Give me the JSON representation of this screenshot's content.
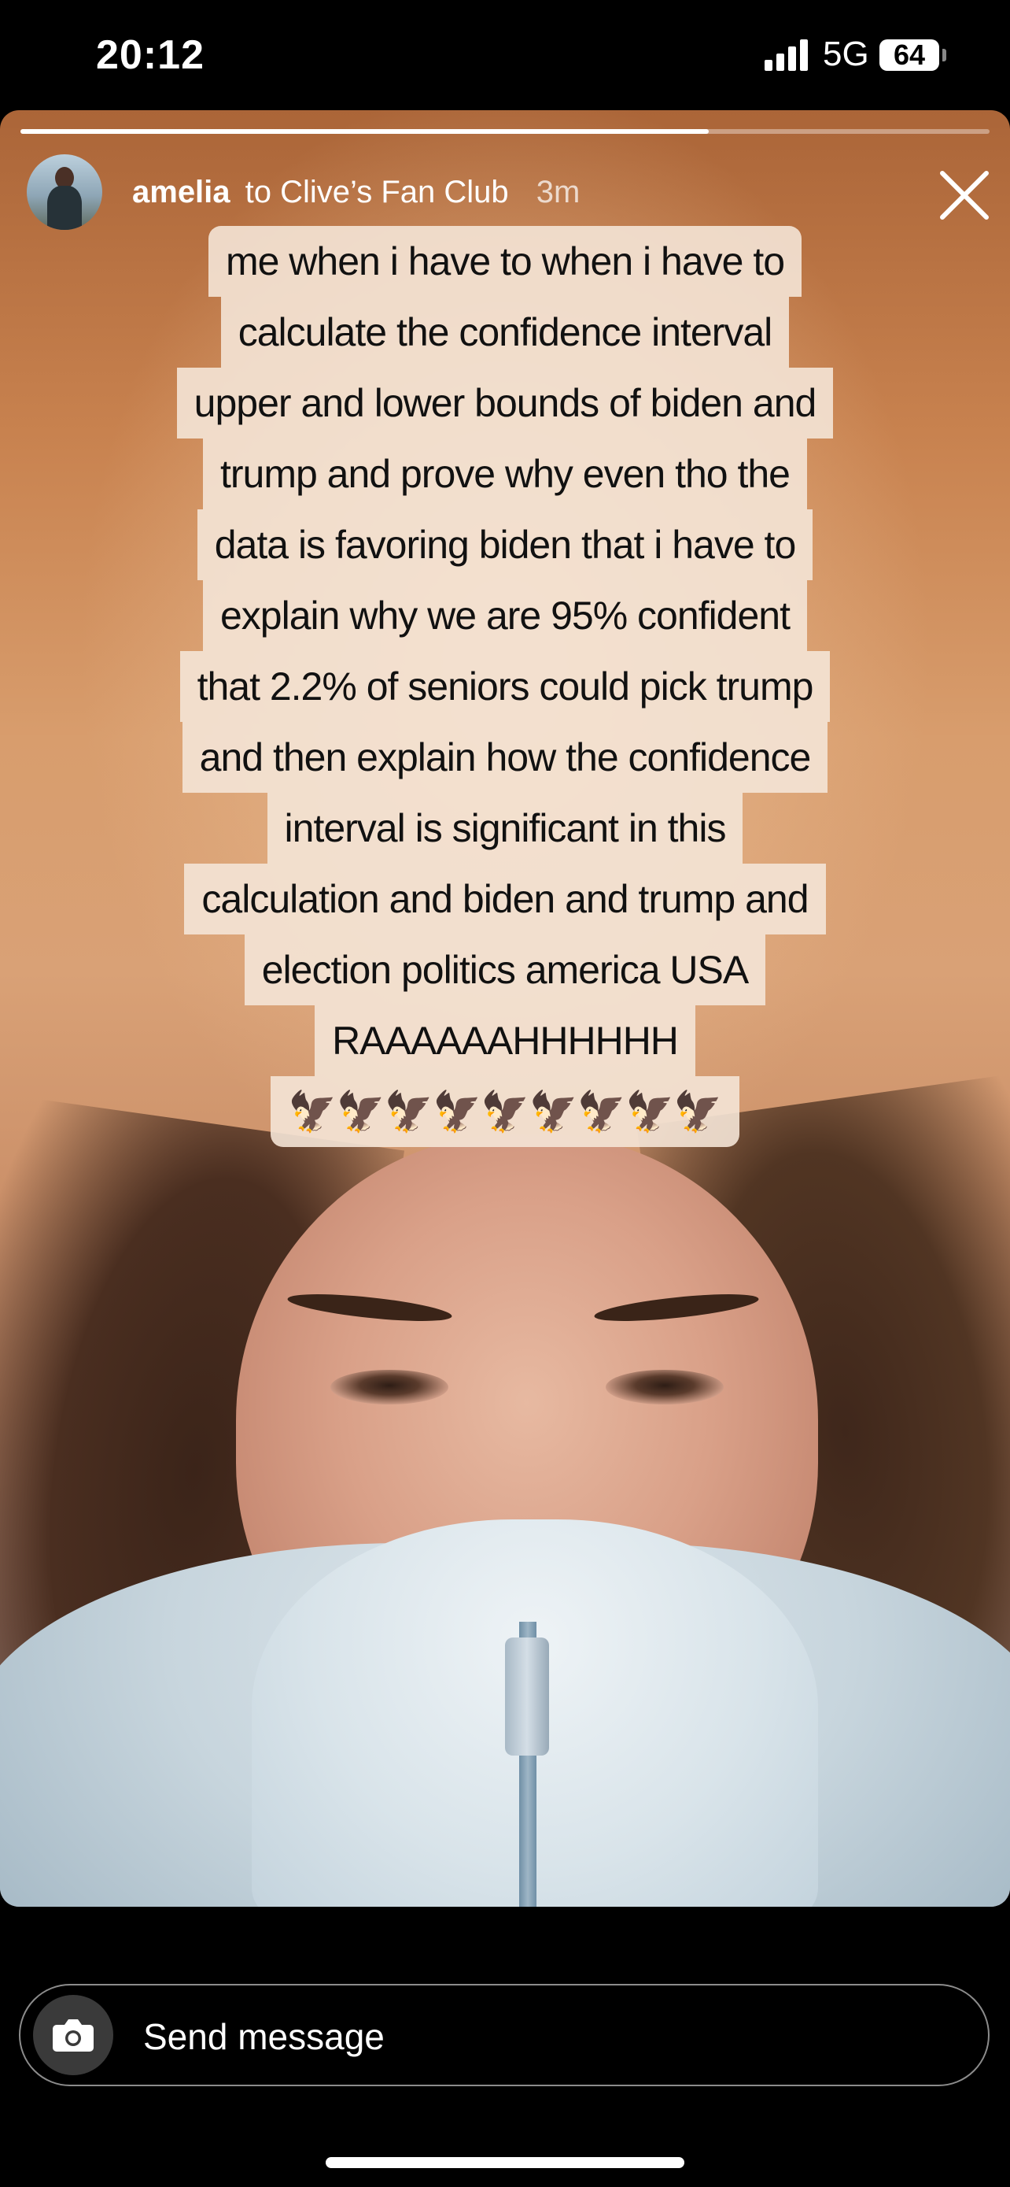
{
  "status_bar": {
    "time": "20:12",
    "network": "5G",
    "battery": "64"
  },
  "story": {
    "progress": 0.71,
    "username": "amelia",
    "audience": "to Clive’s Fan Club",
    "posted_ago": "3m",
    "caption_lines": [
      "me when i have to when i have to",
      "calculate the confidence interval",
      "upper and lower bounds of biden and",
      "trump and prove why even tho the",
      "data is favoring biden that i have to",
      "explain why we are 95% confident",
      "that 2.2% of seniors could pick trump",
      "and then explain how the confidence",
      "interval is significant in this",
      "calculation and biden and trump and",
      "election politics america USA",
      "RAAAAAAHHHHHH",
      "🦅🦅🦅🦅🦅🦅🦅🦅🦅"
    ]
  },
  "icons": {
    "close": "close-icon",
    "camera": "camera-icon"
  },
  "message_bar": {
    "placeholder": "Send message"
  }
}
